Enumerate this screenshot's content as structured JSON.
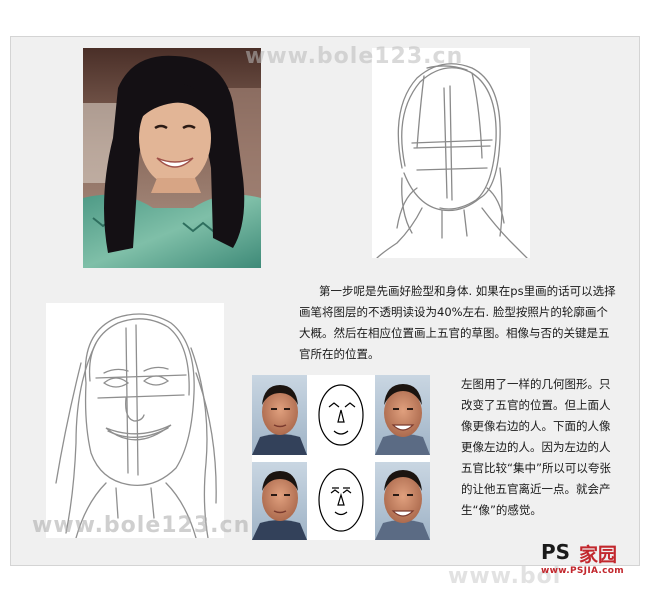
{
  "watermarks": {
    "top": "www.bole123.cn",
    "bottom_left": "www.bole123.cn",
    "bottom_right": "www.bol"
  },
  "text": {
    "paragraph1": "第一步呢是先画好脸型和身体. 如果在ps里画的话可以选择画笔将图层的不透明读设为40%左右. 脸型按照片的轮廓画个大概。然后在相应位置画上五官的草图。相像与否的关键是五官所在的位置。",
    "paragraph2": "左图用了一样的几何图形。只改变了五官的位置。但上面人像更像右边的人。下面的人像更像左边的人。因为左边的人五官比较“集中”所以可以夸张的让他五官离近一点。就会产生“像”的感觉。"
  },
  "logo": {
    "ps": "PS",
    "cn": "家园",
    "url": "www.PSJIA.com"
  },
  "colors": {
    "panel_bg": "#f0f0f0",
    "sketch_line": "#8a8a8a",
    "logo_red": "#c2272d"
  }
}
